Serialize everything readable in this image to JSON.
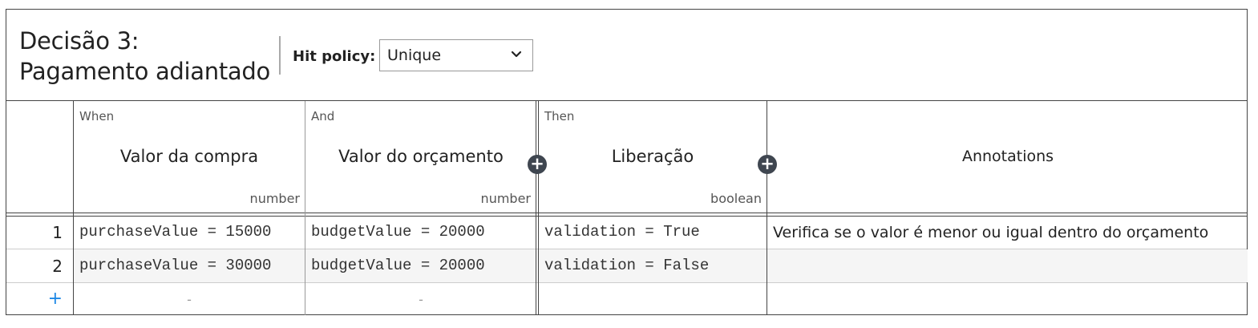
{
  "decision": {
    "title_line1": "Decisão 3:",
    "title_line2": "Pagamento adiantado",
    "hit_policy_label": "Hit policy:",
    "hit_policy_value": "Unique"
  },
  "columns": [
    {
      "clause": "When",
      "name": "Valor da compra",
      "type": "number"
    },
    {
      "clause": "And",
      "name": "Valor do orçamento",
      "type": "number"
    },
    {
      "clause": "Then",
      "name": "Liberação",
      "type": "boolean"
    },
    {
      "clause": "",
      "name": "Annotations",
      "type": ""
    }
  ],
  "rows": [
    {
      "num": "1",
      "input1": "purchaseValue = 15000",
      "input2": "budgetValue = 20000",
      "output": "validation = True",
      "annotation": "Verifica se o valor é menor ou igual dentro do orçamento"
    },
    {
      "num": "2",
      "input1": "purchaseValue = 30000",
      "input2": "budgetValue = 20000",
      "output": "validation = False",
      "annotation": ""
    }
  ],
  "new_row": {
    "add_symbol": "+",
    "placeholder1": "-",
    "placeholder2": "-"
  },
  "add_column_symbol": "+",
  "colors": {
    "border": "#444444",
    "alt_row": "#f5f5f5",
    "add_blue": "#1e88e5",
    "plus_bg": "#3f4650"
  }
}
